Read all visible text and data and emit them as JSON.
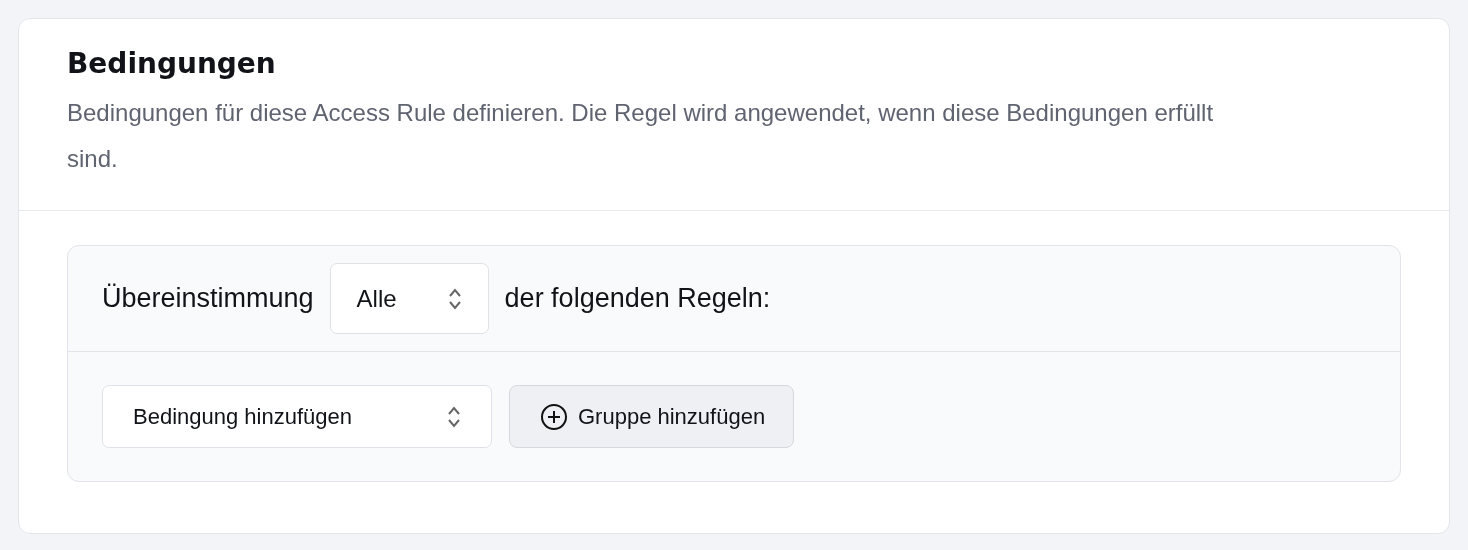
{
  "card": {
    "title": "Bedingungen",
    "description": "Bedingungen für diese Access Rule definieren. Die Regel wird angewendet, wenn diese Bedingungen erfüllt sind."
  },
  "match": {
    "prefix": "Übereinstimmung",
    "select": "Alle",
    "suffix": "der folgenden Regeln:"
  },
  "actions": [
    {
      "kind": "select",
      "label": "Bedingung hinzufügen"
    },
    {
      "kind": "button",
      "label": "Gruppe hinzufügen"
    }
  ]
}
